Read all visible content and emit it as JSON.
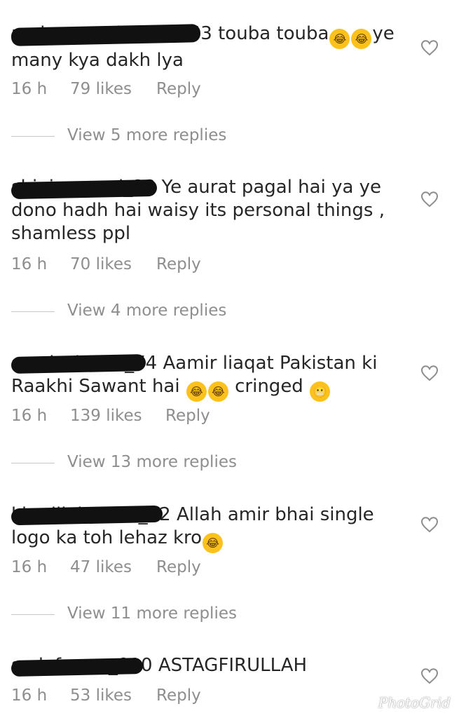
{
  "comments": [
    {
      "username": "mohammadzubair353",
      "text": "touba touba",
      "emoji": [
        "joy-emoji",
        "joy-emoji"
      ],
      "text_after": "ye many kya dakh lya",
      "time": "16 h",
      "likes": "79 likes",
      "reply": "Reply",
      "view_more": "View 5 more replies"
    },
    {
      "username": "shiningpearl_23",
      "text": "Ye aurat pagal hai ya ye dono hadh hai waisy its personal things , shamless ppl",
      "time": "16 h",
      "likes": "70 likes",
      "reply": "Reply",
      "view_more": "View 4 more replies"
    },
    {
      "username": "syedasheikh_74",
      "text": "Aamir liaqat Pakistan ki Raakhi Sawant hai",
      "emoji": [
        "joy-emoji",
        "joy-emoji"
      ],
      "text_after": "cringed",
      "emoji_after": "grimacing-emoji",
      "time": "16 h",
      "likes": "139 likes",
      "reply": "Reply",
      "view_more": "View 13 more replies"
    },
    {
      "username": "khadijahmalik_12",
      "text": "Allah amir bhai single logo ka toh lehaz kro",
      "emoji": [
        "joy-emoji"
      ],
      "time": "16 h",
      "likes": "47 likes",
      "reply": "Reply",
      "view_more": "View 11 more replies"
    },
    {
      "username": "sadafomar_010",
      "text": "ASTAGFIRULLAH",
      "time": "16 h",
      "likes": "53 likes",
      "reply": "Reply"
    }
  ],
  "watermark": "PhotoGrid",
  "colors": {
    "text": "#262626",
    "meta": "#8e8e8e",
    "divider": "#c7c7c7"
  }
}
